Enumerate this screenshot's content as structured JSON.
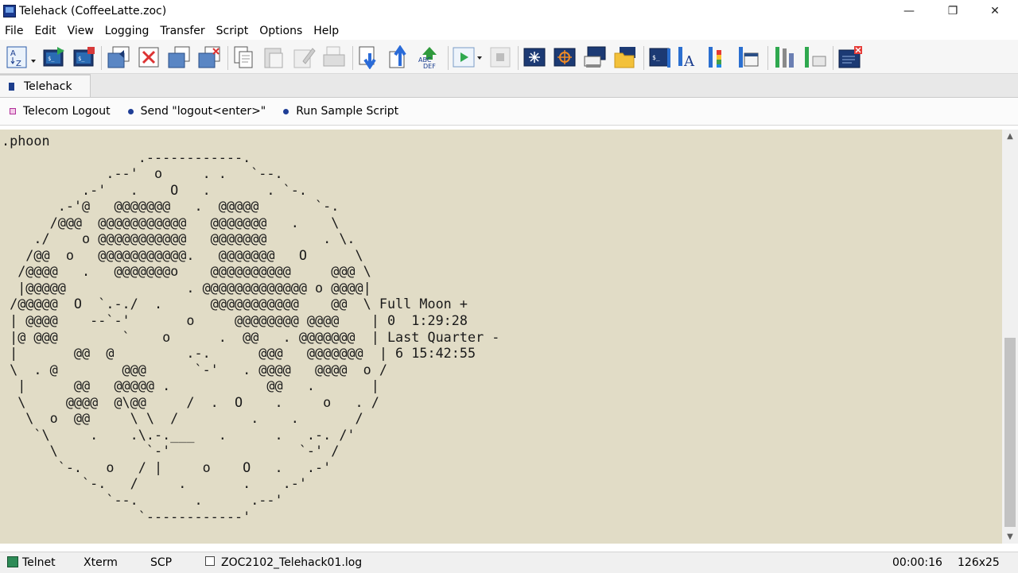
{
  "window": {
    "title": "Telehack (CoffeeLatte.zoc)",
    "minimize_glyph": "—",
    "maximize_glyph": "❐",
    "close_glyph": "✕"
  },
  "menu": [
    "File",
    "Edit",
    "View",
    "Logging",
    "Transfer",
    "Script",
    "Options",
    "Help"
  ],
  "toolbar_icons": [
    "sort-az-icon",
    "connect-icon",
    "disconnect-icon",
    "host-back-icon",
    "host-x-icon",
    "host-new-icon",
    "host-close-icon",
    "copy-icon",
    "paste-icon",
    "edit-icon",
    "print-icon",
    "download-icon",
    "upload-icon",
    "abc-def-icon",
    "play-script-icon",
    "stop-script-icon",
    "compass-icon",
    "target-icon",
    "computer-icon",
    "folder-icon",
    "console-icon",
    "font-icon",
    "colors-icon",
    "window-icon",
    "tools-icon",
    "settings-tubes-icon",
    "exit-icon"
  ],
  "tabs": [
    {
      "label": "Telehack"
    }
  ],
  "buttonbar": [
    {
      "label": "Telecom Logout"
    },
    {
      "label": "Send \"logout<enter>\""
    },
    {
      "label": "Run Sample Script"
    }
  ],
  "terminal": {
    "background": "#e1dcc6",
    "text": ".phoon\n                 .------------.\n             .--'  o     . .   `--.\n          .-'   .    O   .       . `-.\n       .-'@   @@@@@@@   .  @@@@@       `-.\n      /@@@  @@@@@@@@@@@   @@@@@@@   .    \\\n    ./    o @@@@@@@@@@@   @@@@@@@       . \\.\n   /@@  o   @@@@@@@@@@@.   @@@@@@@   O      \\\n  /@@@@   .   @@@@@@@o    @@@@@@@@@@     @@@ \\\n  |@@@@@               . @@@@@@@@@@@@@ o @@@@|\n /@@@@@  O  `.-./  .      @@@@@@@@@@@    @@  \\ Full Moon +\n | @@@@    --`-'       o     @@@@@@@@ @@@@    | 0  1:29:28\n |@ @@@        `    o      .  @@   . @@@@@@@  | Last Quarter -\n |       @@  @         .-.      @@@   @@@@@@@  | 6 15:42:55\n \\  . @        @@@      `-'   . @@@@   @@@@  o /\n  |      @@   @@@@@ .            @@   .       |\n  \\     @@@@  @\\@@     /  .  O    .     o   . /\n   \\  o  @@     \\ \\  /         .    .       /\n    `\\     .    .\\.-.___   .      .   .-. /'\n      \\           `-'                `-' /\n       `-.   o   / |     o    O   .   .-'\n          `-.   /     .       .    .-'\n             `--.       .      .--'\n                 `------------'\n\n._"
  },
  "status": {
    "protocol": "Telnet",
    "emulation": "Xterm",
    "transfer": "SCP",
    "logfile": "ZOC2102_Telehack01.log",
    "elapsed": "00:00:16",
    "size": "126x25"
  }
}
